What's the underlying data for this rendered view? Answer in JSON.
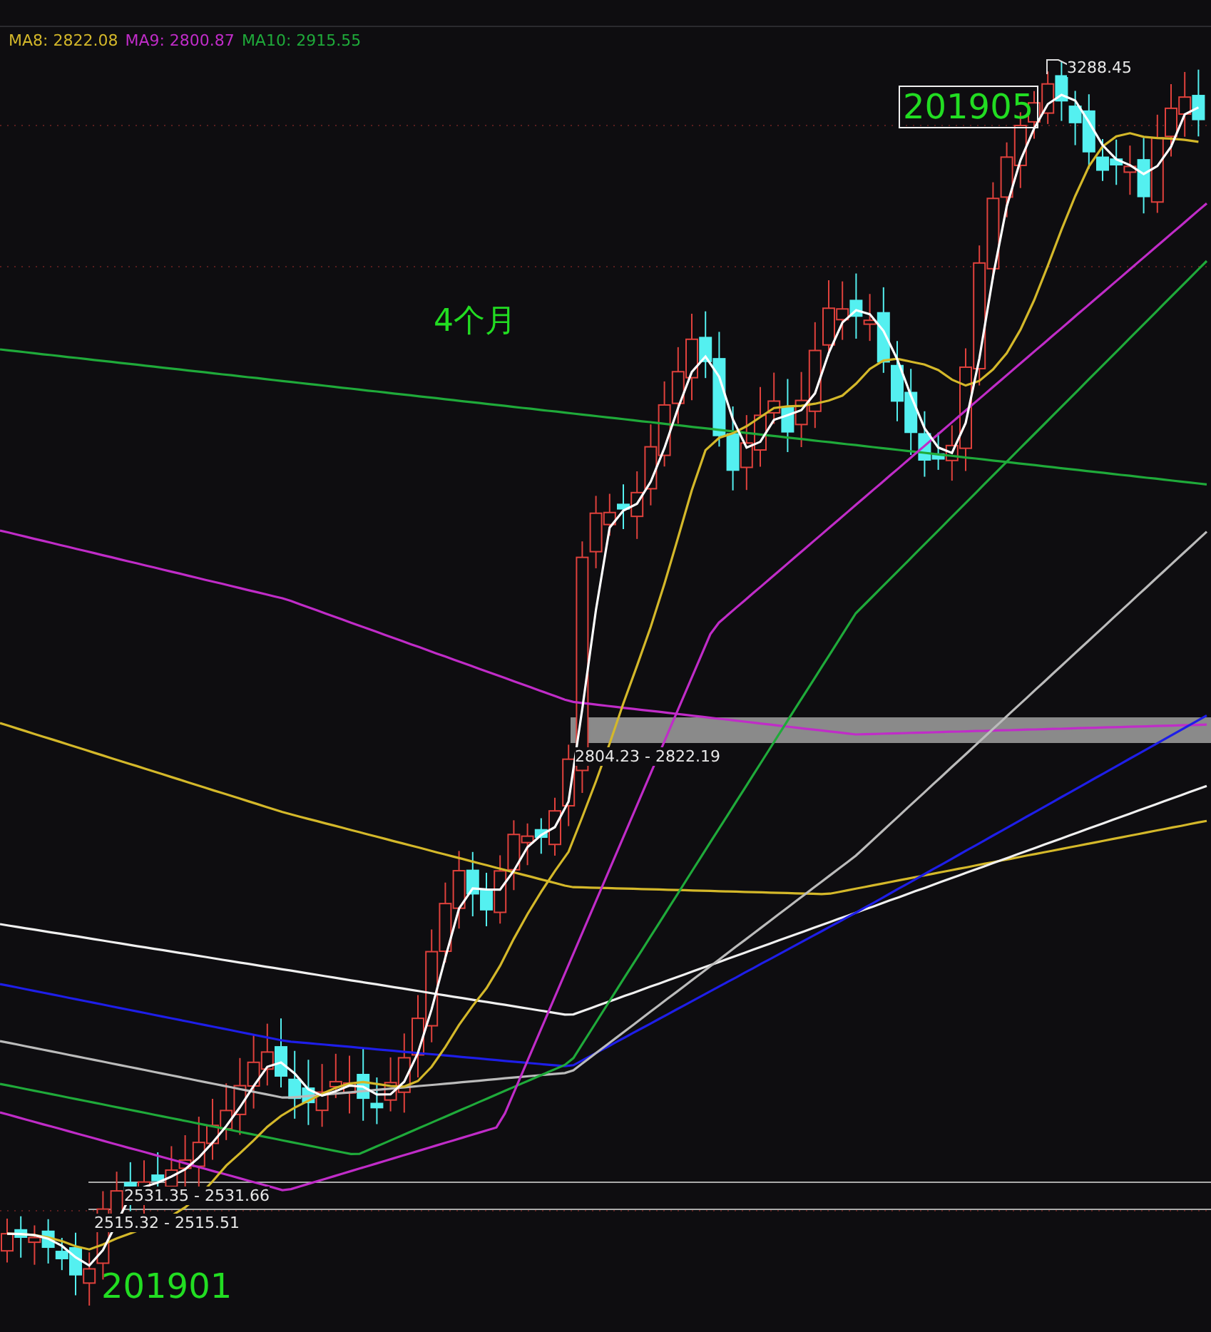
{
  "legend": [
    {
      "label": "MA8: 2822.08",
      "color": "#d4b82a"
    },
    {
      "label": "MA9: 2800.87",
      "color": "#c02cc8"
    },
    {
      "label": "MA10: 2915.55",
      "color": "#1faa3a"
    }
  ],
  "chart": {
    "high_label": "3288.45",
    "highlight_range": "2804.23 - 2822.19",
    "range_labels": [
      "2531.35 - 2531.66",
      "2515.32 - 2515.51"
    ],
    "period_labels": [
      {
        "text": "201905",
        "boxed": true
      },
      {
        "text": "201901",
        "boxed": false
      }
    ],
    "duration_note": "4个月"
  }
}
